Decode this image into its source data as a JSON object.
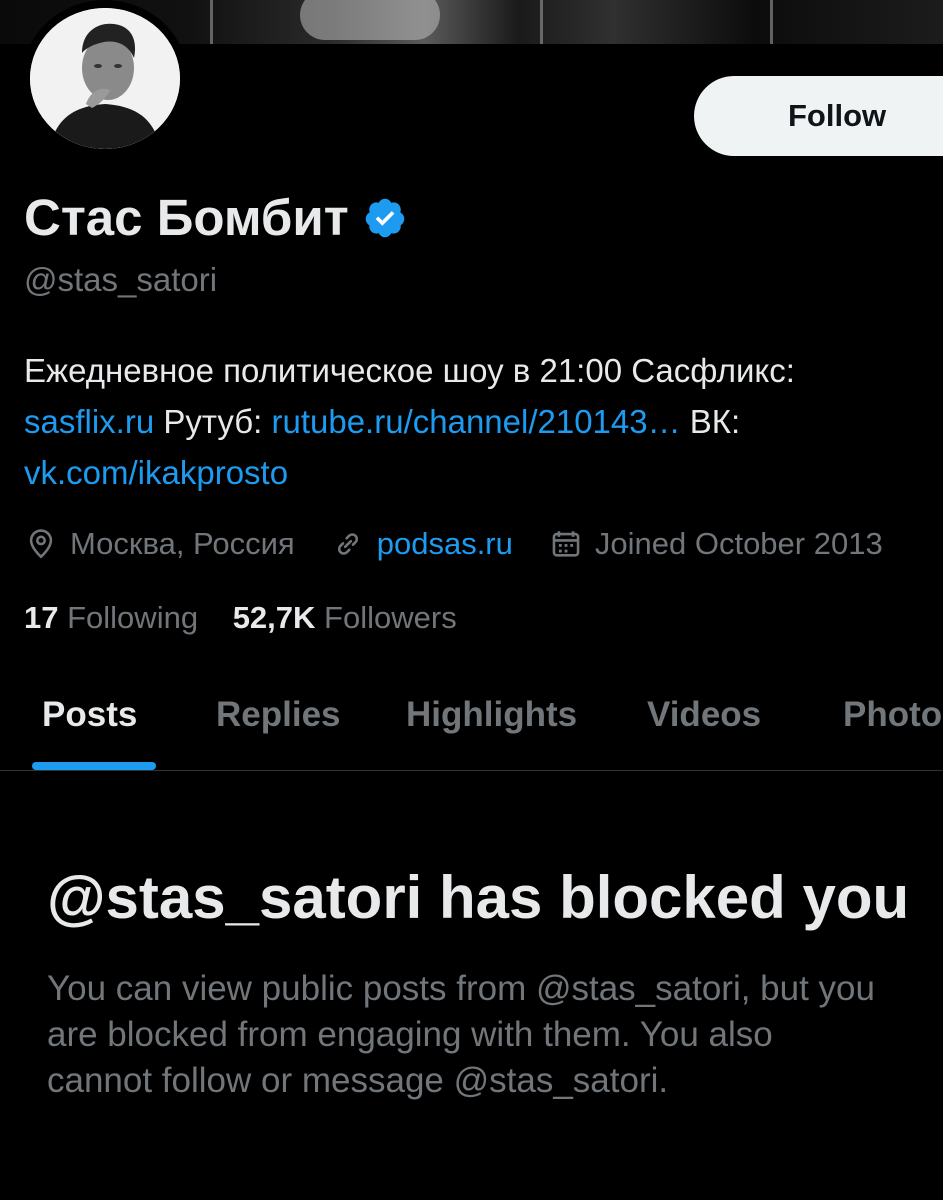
{
  "profile": {
    "name": "Стас Бомбит",
    "handle": "@stas_satori",
    "follow_label": "Follow"
  },
  "bio": {
    "text1": "Ежедневное политическое шоу в 21:00 Сасфликс:",
    "link1": "sasflix.ru",
    "text2": " Рутуб: ",
    "link2": "rutube.ru/channel/210143…",
    "text3": " ВК:",
    "link3": "vk.com/ikakprosto"
  },
  "meta": {
    "location": "Москва, Россия",
    "website": "podsas.ru",
    "joined": "Joined October 2013"
  },
  "stats": {
    "following_count": "17",
    "following_label": "Following",
    "followers_count": "52,7K",
    "followers_label": "Followers"
  },
  "tabs": [
    {
      "label": "Posts"
    },
    {
      "label": "Replies"
    },
    {
      "label": "Highlights"
    },
    {
      "label": "Videos"
    },
    {
      "label": "Photos"
    }
  ],
  "blocked": {
    "title": "@stas_satori has blocked you",
    "line1": "You can view public posts from @stas_satori, but you",
    "line2": "are blocked from engaging with them. You also",
    "line3": "cannot follow or message @stas_satori."
  },
  "colors": {
    "accent": "#1d9bf0",
    "background": "#000000",
    "text_primary": "#e7e9ea",
    "text_secondary": "#71767b",
    "button_bg": "#eff3f4"
  },
  "icons": {
    "verified": "verified-badge-icon",
    "location": "location-pin-icon",
    "website": "link-icon",
    "joined": "calendar-icon"
  }
}
